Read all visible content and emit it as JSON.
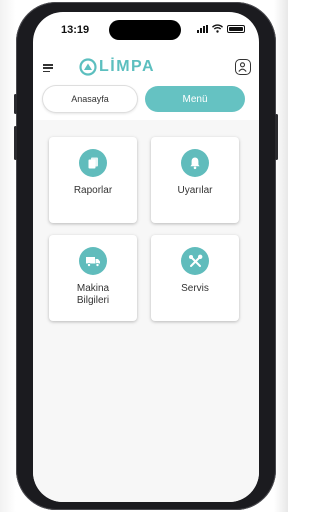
{
  "status_bar": {
    "time": "13:19"
  },
  "header": {
    "logo_text": "LİMPA"
  },
  "tabs": [
    {
      "label": "Anasayfa",
      "active": false
    },
    {
      "label": "Menü",
      "active": true
    }
  ],
  "menu_cards": [
    {
      "label": "Raporlar",
      "icon": "reports-icon"
    },
    {
      "label": "Uyarılar",
      "icon": "bell-icon"
    },
    {
      "label": "Makina Bilgileri",
      "icon": "truck-icon"
    },
    {
      "label": "Servis",
      "icon": "tools-icon"
    }
  ],
  "colors": {
    "accent": "#65c2c2",
    "background": "#f7f7f7"
  }
}
